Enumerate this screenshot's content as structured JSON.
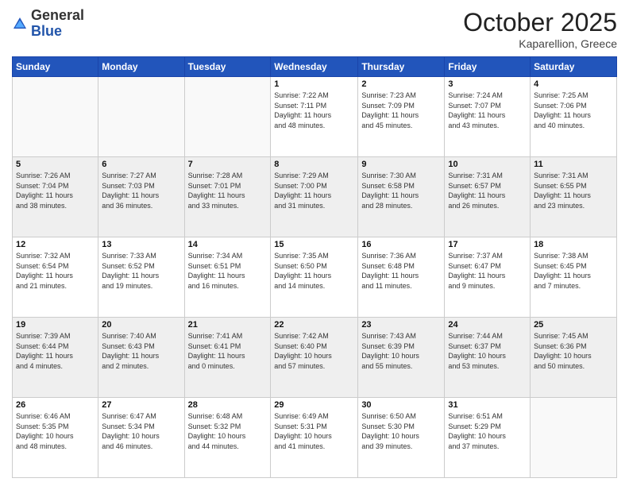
{
  "header": {
    "logo_general": "General",
    "logo_blue": "Blue",
    "month": "October 2025",
    "location": "Kaparellion, Greece"
  },
  "days_of_week": [
    "Sunday",
    "Monday",
    "Tuesday",
    "Wednesday",
    "Thursday",
    "Friday",
    "Saturday"
  ],
  "weeks": [
    [
      {
        "day": "",
        "info": ""
      },
      {
        "day": "",
        "info": ""
      },
      {
        "day": "",
        "info": ""
      },
      {
        "day": "1",
        "info": "Sunrise: 7:22 AM\nSunset: 7:11 PM\nDaylight: 11 hours\nand 48 minutes."
      },
      {
        "day": "2",
        "info": "Sunrise: 7:23 AM\nSunset: 7:09 PM\nDaylight: 11 hours\nand 45 minutes."
      },
      {
        "day": "3",
        "info": "Sunrise: 7:24 AM\nSunset: 7:07 PM\nDaylight: 11 hours\nand 43 minutes."
      },
      {
        "day": "4",
        "info": "Sunrise: 7:25 AM\nSunset: 7:06 PM\nDaylight: 11 hours\nand 40 minutes."
      }
    ],
    [
      {
        "day": "5",
        "info": "Sunrise: 7:26 AM\nSunset: 7:04 PM\nDaylight: 11 hours\nand 38 minutes."
      },
      {
        "day": "6",
        "info": "Sunrise: 7:27 AM\nSunset: 7:03 PM\nDaylight: 11 hours\nand 36 minutes."
      },
      {
        "day": "7",
        "info": "Sunrise: 7:28 AM\nSunset: 7:01 PM\nDaylight: 11 hours\nand 33 minutes."
      },
      {
        "day": "8",
        "info": "Sunrise: 7:29 AM\nSunset: 7:00 PM\nDaylight: 11 hours\nand 31 minutes."
      },
      {
        "day": "9",
        "info": "Sunrise: 7:30 AM\nSunset: 6:58 PM\nDaylight: 11 hours\nand 28 minutes."
      },
      {
        "day": "10",
        "info": "Sunrise: 7:31 AM\nSunset: 6:57 PM\nDaylight: 11 hours\nand 26 minutes."
      },
      {
        "day": "11",
        "info": "Sunrise: 7:31 AM\nSunset: 6:55 PM\nDaylight: 11 hours\nand 23 minutes."
      }
    ],
    [
      {
        "day": "12",
        "info": "Sunrise: 7:32 AM\nSunset: 6:54 PM\nDaylight: 11 hours\nand 21 minutes."
      },
      {
        "day": "13",
        "info": "Sunrise: 7:33 AM\nSunset: 6:52 PM\nDaylight: 11 hours\nand 19 minutes."
      },
      {
        "day": "14",
        "info": "Sunrise: 7:34 AM\nSunset: 6:51 PM\nDaylight: 11 hours\nand 16 minutes."
      },
      {
        "day": "15",
        "info": "Sunrise: 7:35 AM\nSunset: 6:50 PM\nDaylight: 11 hours\nand 14 minutes."
      },
      {
        "day": "16",
        "info": "Sunrise: 7:36 AM\nSunset: 6:48 PM\nDaylight: 11 hours\nand 11 minutes."
      },
      {
        "day": "17",
        "info": "Sunrise: 7:37 AM\nSunset: 6:47 PM\nDaylight: 11 hours\nand 9 minutes."
      },
      {
        "day": "18",
        "info": "Sunrise: 7:38 AM\nSunset: 6:45 PM\nDaylight: 11 hours\nand 7 minutes."
      }
    ],
    [
      {
        "day": "19",
        "info": "Sunrise: 7:39 AM\nSunset: 6:44 PM\nDaylight: 11 hours\nand 4 minutes."
      },
      {
        "day": "20",
        "info": "Sunrise: 7:40 AM\nSunset: 6:43 PM\nDaylight: 11 hours\nand 2 minutes."
      },
      {
        "day": "21",
        "info": "Sunrise: 7:41 AM\nSunset: 6:41 PM\nDaylight: 11 hours\nand 0 minutes."
      },
      {
        "day": "22",
        "info": "Sunrise: 7:42 AM\nSunset: 6:40 PM\nDaylight: 10 hours\nand 57 minutes."
      },
      {
        "day": "23",
        "info": "Sunrise: 7:43 AM\nSunset: 6:39 PM\nDaylight: 10 hours\nand 55 minutes."
      },
      {
        "day": "24",
        "info": "Sunrise: 7:44 AM\nSunset: 6:37 PM\nDaylight: 10 hours\nand 53 minutes."
      },
      {
        "day": "25",
        "info": "Sunrise: 7:45 AM\nSunset: 6:36 PM\nDaylight: 10 hours\nand 50 minutes."
      }
    ],
    [
      {
        "day": "26",
        "info": "Sunrise: 6:46 AM\nSunset: 5:35 PM\nDaylight: 10 hours\nand 48 minutes."
      },
      {
        "day": "27",
        "info": "Sunrise: 6:47 AM\nSunset: 5:34 PM\nDaylight: 10 hours\nand 46 minutes."
      },
      {
        "day": "28",
        "info": "Sunrise: 6:48 AM\nSunset: 5:32 PM\nDaylight: 10 hours\nand 44 minutes."
      },
      {
        "day": "29",
        "info": "Sunrise: 6:49 AM\nSunset: 5:31 PM\nDaylight: 10 hours\nand 41 minutes."
      },
      {
        "day": "30",
        "info": "Sunrise: 6:50 AM\nSunset: 5:30 PM\nDaylight: 10 hours\nand 39 minutes."
      },
      {
        "day": "31",
        "info": "Sunrise: 6:51 AM\nSunset: 5:29 PM\nDaylight: 10 hours\nand 37 minutes."
      },
      {
        "day": "",
        "info": ""
      }
    ]
  ]
}
